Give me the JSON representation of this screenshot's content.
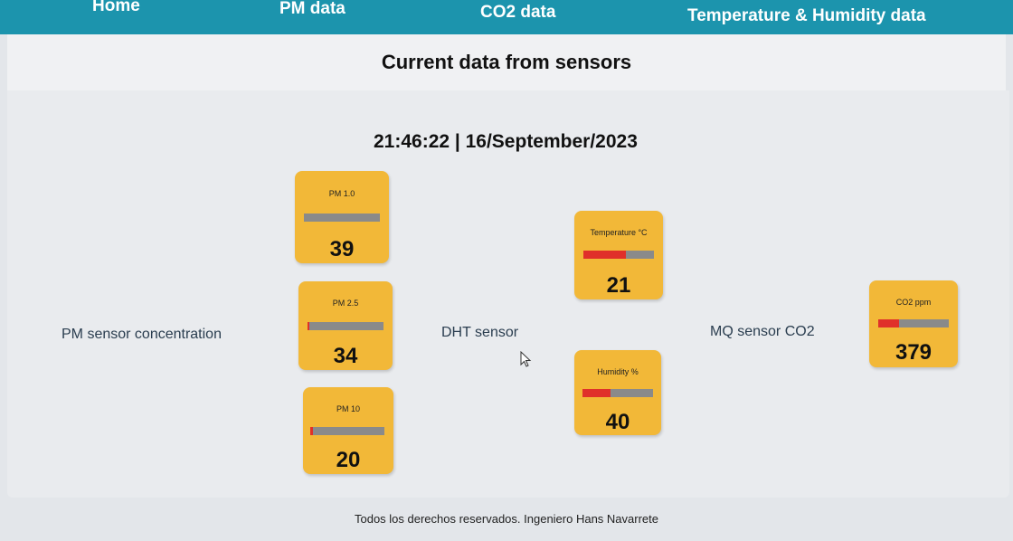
{
  "nav": {
    "home": "Home",
    "pm": "PM data",
    "co2": "CO2 data",
    "temp_hum": "Temperature & Humidity data"
  },
  "page_title": "Current data from sensors",
  "datetime": "21:46:22 | 16/September/2023",
  "groups": {
    "pm": "PM sensor concentration",
    "dht": "DHT sensor",
    "mq": "MQ sensor CO2"
  },
  "cards": {
    "pm1": {
      "label": "PM 1.0",
      "value": "39",
      "level": 0
    },
    "pm25": {
      "label": "PM 2.5",
      "value": "34",
      "level": 0.02
    },
    "pm10": {
      "label": "PM 10",
      "value": "20",
      "level": 0.04
    },
    "temp": {
      "label": "Temperature °C",
      "value": "21",
      "level": 0.6
    },
    "hum": {
      "label": "Humidity %",
      "value": "40",
      "level": 0.4
    },
    "co2": {
      "label": "CO2 ppm",
      "value": "379",
      "level": 0.3
    }
  },
  "colors": {
    "navbar": "#1c94ad",
    "card": "#f2b838",
    "bar_fill": "#e0302a",
    "bar_track": "#8a8a8a"
  },
  "footer": "Todos los derechos reservados. Ingeniero Hans Navarrete"
}
